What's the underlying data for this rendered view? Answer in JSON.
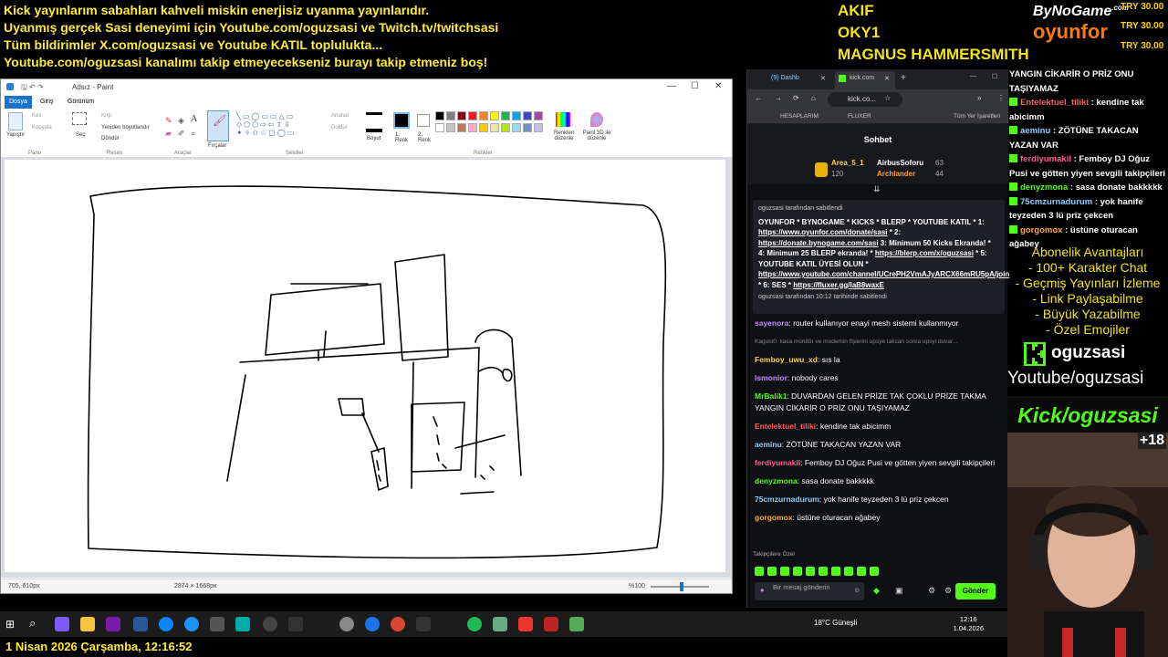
{
  "banner": {
    "line1": "Kick yayınlarım sabahları kahveli miskin enerjisiz uyanma yayınlarıdır.",
    "line2": "Uyanmış gerçek Sasi deneyimi için Youtube.com/oguzsasi ve Twitch.tv/twitchsasi",
    "line3": "Tüm bildirimler X.com/oguzsasi ve Youtube KATIL toplulukta...",
    "line4": "Youtube.com/oguzsasi kanalımı takip etmeyecekseniz burayı takip etmeniz boş!"
  },
  "donors": {
    "name1": "AKIF",
    "name2": "OKY1",
    "name3": "MAGNUS HAMMERSMITH",
    "amounts": [
      "TRY 30.00",
      "TRY 30.00",
      "TRY 30.00"
    ]
  },
  "brand": {
    "top": "ByNoGame",
    "top_suffix": ".com",
    "bottom": "oyunfor"
  },
  "paint": {
    "title": "Adsız - Paint",
    "tabs": [
      "Dosya",
      "Giriş",
      "Görünüm"
    ],
    "groups": [
      "Pano",
      "Resim",
      "Araçlar",
      "Şekiller",
      "Renkler"
    ],
    "clipboard": {
      "paste": "Yapıştır",
      "cut": "Kes",
      "copy": "Kopyala"
    },
    "image": {
      "select": "Seç",
      "crop": "Kırp",
      "resize": "Yeniden boyutlandır",
      "rotate": "Döndür"
    },
    "brushes": "Fırçalar",
    "shapes": {
      "outline": "Anahat",
      "fill": "Doldur"
    },
    "size": "Boyut",
    "color1": "1. Renk",
    "color2": "2. Renk",
    "edit_colors": "Renkleri düzenle",
    "paint3d": "Paint 3D ile düzenle",
    "palette": [
      "#000000",
      "#7f7f7f",
      "#880015",
      "#ed1c24",
      "#ff7f27",
      "#fff200",
      "#22b14c",
      "#00a2e8",
      "#3f48cc",
      "#a349a4",
      "#ffffff",
      "#c3c3c3",
      "#b97a57",
      "#ffaec9",
      "#ffc90e",
      "#efe4b0",
      "#b5e61d",
      "#99d9ea",
      "#7092be",
      "#c8bfe7"
    ],
    "status": {
      "cursor": "705, 610px",
      "size": "2874 × 1668px",
      "zoom": "%100"
    }
  },
  "browser": {
    "tab1": "(9) Dashb",
    "tab2": "kick.com",
    "address": "kick.co...",
    "bookmarks": [
      "HESAPLARIM",
      "FLUXER",
      "Tüm Yer İşaretleri"
    ]
  },
  "kickchat": {
    "header": "Sohbet",
    "leaders": [
      {
        "name": "Area_5_1",
        "score": "120"
      },
      {
        "name": "AirbusSoforu",
        "score": "63"
      },
      {
        "name": "Archlander",
        "score": "44"
      }
    ],
    "pinned_by": "oguzsasi tarafından sabitlendi",
    "pinned_text": "OYUNFOR * BYNOGAME * KICKS * BLERP * YOUTUBE KATIL * 1:",
    "pinned_links": [
      "https://www.oyunfor.com/donate/sasi",
      "https://donate.bynogame.com/sasi",
      "https://blerp.com/x/oguzsasi",
      "https://www.youtube.com/channel/UCrePH2VmAJyARCX66mRU5pA/join",
      "https://fluxer.gg/laB8waxE"
    ],
    "pinned_parts": [
      " * 2:",
      " 3: Minimum 50 Kicks Ekranda! * 4: Minimum 25 BLERP ekranda! *",
      " * 5: YOUTUBE KATIL ÜYESİ OLUN *",
      " * 6: SES *"
    ],
    "pinned_footer": "oguzsasi tarafından 10:12 tarihinde sabitlendi",
    "messages": [
      {
        "user": "sayenora",
        "color": "#c78cff",
        "text": "router kullanıyor enayi mesh sistemi kullanmıyor"
      },
      {
        "user": "Kagust0",
        "color": "#888888",
        "text": "kasa monitör ve modemin fişlerini upsye takcan sonra upsyi duvar..."
      },
      {
        "user": "Femboy_uwu_xd",
        "color": "#ffd24c",
        "text": "sıs la"
      },
      {
        "user": "lsmonior",
        "color": "#c78cff",
        "text": "nobody cares"
      },
      {
        "user": "MrBalik1",
        "color": "#53fc18",
        "text": "DUVARDAN GELEN PRİZE TAK ÇOKLU PRİZE TAKMA YANGIN CİKARİR O PRİZ ONU TAŞIYAMAZ"
      },
      {
        "user": "Entelektuel_tiliki",
        "color": "#ff5f5f",
        "text": "kendine tak abicimm"
      },
      {
        "user": "aeminu",
        "color": "#8fd0ff",
        "text": "ZÖTÜNE TAKACAN YAZAN VAR"
      },
      {
        "user": "ferdiyumakil",
        "color": "#ff5f8f",
        "text": "Femboy DJ Oğuz Pusi ve götten yiyen sevgili takipçileri"
      },
      {
        "user": "denyzmona",
        "color": "#53fc18",
        "text": "sasa donate bakkkkk"
      },
      {
        "user": "75cmzurnadurum",
        "color": "#8fd0ff",
        "text": "yok hanife teyzeden 3 lü priz çekcen"
      },
      {
        "user": "gorgomox",
        "color": "#ffa64c",
        "text": "üstüne oturacan ağabey"
      }
    ],
    "followers_only": "Takipçilere Özel",
    "input_placeholder": "Bir mesaj gönderin",
    "send": "Gönder"
  },
  "overlay_chat": [
    {
      "user": "",
      "text": "YANGIN CİKARİR O PRİZ ONU TAŞIYAMAZ"
    },
    {
      "user": "Entelektuel_tiliki",
      "text": "kendine tak abicimm"
    },
    {
      "user": "aeminu",
      "text": "ZÖTÜNE TAKACAN YAZAN VAR"
    },
    {
      "user": "ferdiyumakil",
      "text": "Femboy DJ Oğuz Pusi ve götten yiyen sevgili takipçileri"
    },
    {
      "user": "denyzmona",
      "text": "sasa donate bakkkkk"
    },
    {
      "user": "75cmzurnadurum",
      "text": "yok hanife teyzeden 3 lü priz çekcen"
    },
    {
      "user": "gorgomox",
      "text": "üstüne oturacan ağabey"
    }
  ],
  "benefits": {
    "title": "Abonelik Avantajları",
    "items": [
      "- 100+ Karakter Chat",
      "- Geçmiş Yayınları İzleme",
      "- Link Paylaşabilme",
      "- Büyük Yazabilme",
      "- Özel Emojiler"
    ]
  },
  "channel": {
    "kick": "oguzsasi",
    "youtube": "Youtube/oguzsasi",
    "kickbar": "Kick/oguzsasi",
    "age": "+18"
  },
  "taskbar": {
    "weather": "18°C  Güneşli",
    "time": "12:16",
    "date": "1.04.2026"
  },
  "footer_date": "1 Nisan 2026 Çarşamba, 12:16:52",
  "colors": {
    "kick_green": "#53fc18",
    "banner_yellow": "#ffeb3b",
    "paint_blue": "#1a73c8"
  }
}
